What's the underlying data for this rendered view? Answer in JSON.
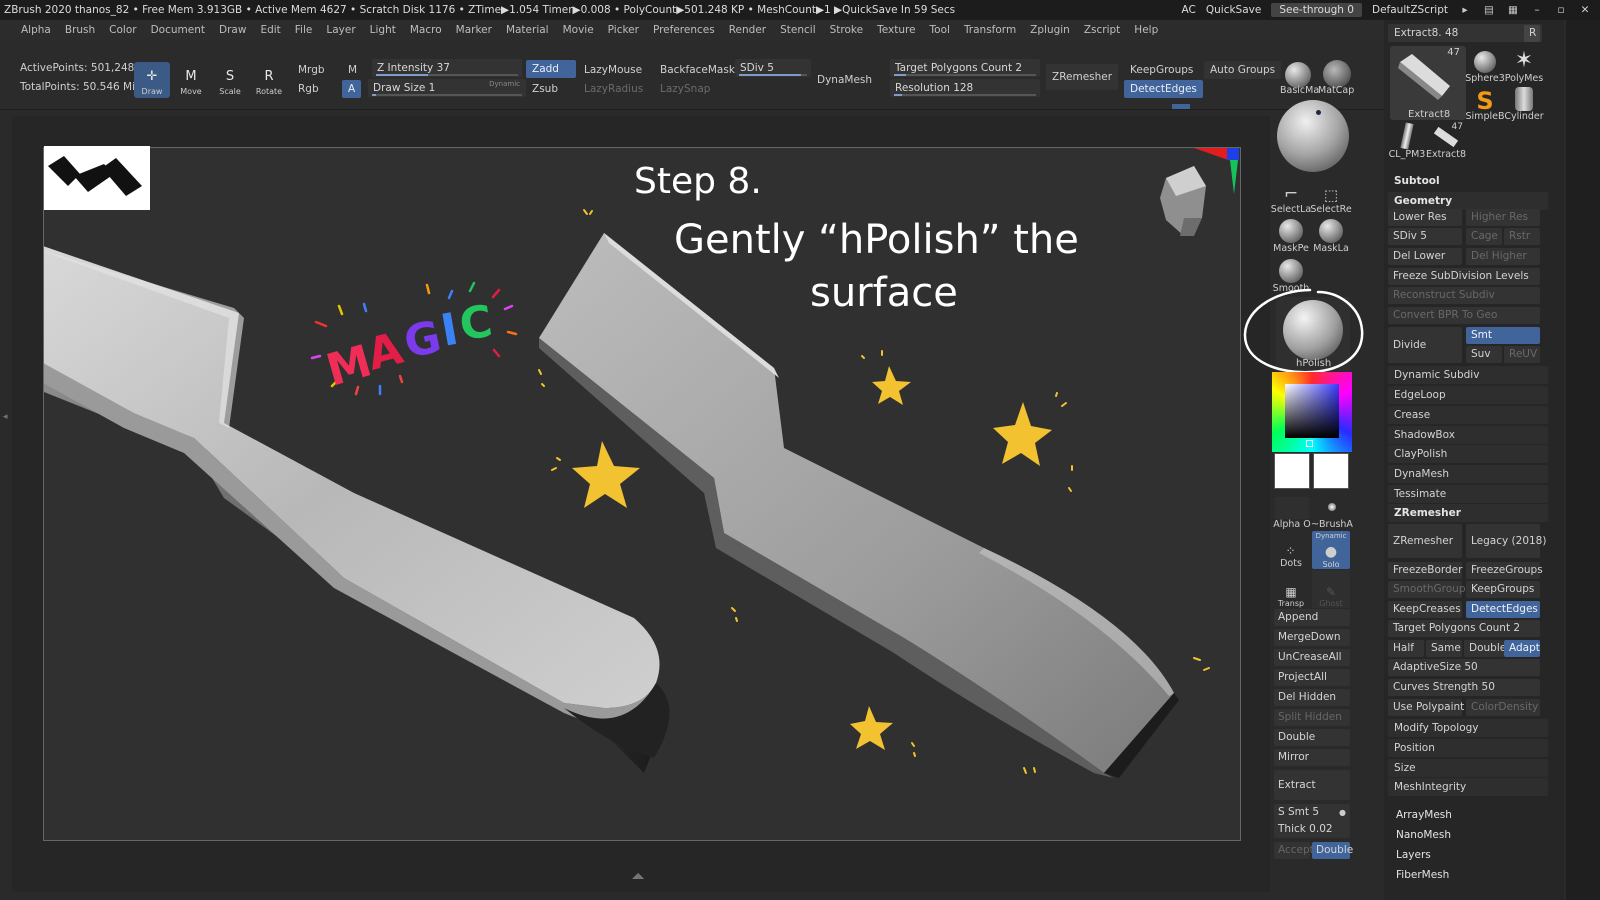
{
  "titlebar": {
    "text": "ZBrush 2020   thanos_82   • Free Mem 3.913GB • Active Mem 4627 • Scratch Disk 1176 • ZTime▶1.054 Timer▶0.008 • PolyCount▶501.248 KP  • MeshCount▶1  ▶QuickSave In 59 Secs",
    "ac": "AC",
    "quicksave": "QuickSave",
    "seethrough": "See-through  0",
    "script": "DefaultZScript"
  },
  "menus": [
    "Alpha",
    "Brush",
    "Color",
    "Document",
    "Draw",
    "Edit",
    "File",
    "Layer",
    "Light",
    "Macro",
    "Marker",
    "Material",
    "Movie",
    "Picker",
    "Preferences",
    "Render",
    "Stencil",
    "Stroke",
    "Texture",
    "Tool",
    "Transform",
    "Zplugin",
    "Zscript",
    "Help"
  ],
  "shelf": {
    "active_points": "ActivePoints: 501,248",
    "total_points": "TotalPoints: 50.546 Mil",
    "tools": [
      "Draw",
      "Move",
      "Scale",
      "Rotate"
    ],
    "mrgb": "Mrgb",
    "m": "M",
    "rgb": "Rgb",
    "a": "A",
    "z_intensity": "Z Intensity 37",
    "draw_size": "Draw Size 1",
    "dynamic": "Dynamic",
    "zadd": "Zadd",
    "zsub": "Zsub",
    "lazymouse": "LazyMouse",
    "lazyradius": "LazyRadius",
    "lazysnap": "LazySnap",
    "backfacemask": "BackfaceMask",
    "sdiv": "SDiv 5",
    "dynamesh": "DynaMesh",
    "target_polygons": "Target Polygons Count 2",
    "resolution": "Resolution 128",
    "zremesher": "ZRemesher",
    "keepgroups": "KeepGroups",
    "auto_groups": "Auto Groups",
    "detect_edges": "DetectEdges",
    "basic_material": "BasicMa",
    "matcap": "MatCap"
  },
  "canvas": {
    "step_title": "Step 8.",
    "caption_line1": "Gently “hPolish” the",
    "caption_line2": "surface",
    "magic": "MAGIC"
  },
  "midcol": {
    "select_lasso": "SelectLa",
    "select_rect": "SelectRe",
    "mask_pen": "MaskPe",
    "mask_lasso": "MaskLa",
    "smooth": "Smooth",
    "hpolish": "hPolish",
    "alpha_off": "Alpha O",
    "brush_alpha": "~BrushA",
    "dots": "Dots",
    "solo": "Solo",
    "dynamic": "Dynamic",
    "transp": "Transp",
    "ghost": "Ghost",
    "buttons": [
      "Append",
      "MergeDown",
      "UnCreaseAll",
      "ProjectAll",
      "Del Hidden",
      "Split Hidden",
      "Double",
      "Mirror"
    ],
    "extract": "Extract",
    "s_smt": "S Smt 5",
    "thick": "Thick 0.02",
    "accept": "Accept",
    "double": "Double"
  },
  "rpanel": {
    "tool_name": "Extract8. 48",
    "r_label": "R",
    "thumbs": [
      "Extract8",
      "Sphere3",
      "PolyMes",
      "SimpleB",
      "Cylinder",
      "CL_PM3",
      "Extract8"
    ],
    "thumb_count": "47",
    "subtool": "Subtool",
    "geometry": "Geometry",
    "lower_res": "Lower Res",
    "higher_res": "Higher Res",
    "sdiv": "SDiv 5",
    "cage": "Cage",
    "rstr": "Rstr",
    "del_lower": "Del Lower",
    "del_higher": "Del Higher",
    "freeze_subdiv": "Freeze SubDivision Levels",
    "reconstruct": "Reconstruct Subdiv",
    "convert_bpr": "Convert BPR To Geo",
    "divide": "Divide",
    "smt": "Smt",
    "suv": "Suv",
    "reuv": "ReUV",
    "dynamic_subdiv": "Dynamic Subdiv",
    "edgeloop": "EdgeLoop",
    "crease": "Crease",
    "shadowbox": "ShadowBox",
    "claypolish": "ClayPolish",
    "dynamesh": "DynaMesh",
    "tessimate": "Tessimate",
    "zremesher_sec": "ZRemesher",
    "zremesher_btn": "ZRemesher",
    "legacy": "Legacy (2018)",
    "freezeborder": "FreezeBorder",
    "freezegroups": "FreezeGroups",
    "smoothgroups": "SmoothGroups",
    "keepgroups": "KeepGroups",
    "keepcreases": "KeepCreases",
    "detectedges": "DetectEdges",
    "target_polygons": "Target Polygons Count 2",
    "half": "Half",
    "same": "Same",
    "double": "Double",
    "adapt": "Adapt",
    "adaptive_size": "AdaptiveSize 50",
    "curves_strength": "Curves Strength 50",
    "use_polypaint": "Use Polypaint",
    "color_density": "ColorDensity",
    "modify_topology": "Modify Topology",
    "position": "Position",
    "size": "Size",
    "meshintegrity": "MeshIntegrity",
    "arraymesh": "ArrayMesh",
    "nanomesh": "NanoMesh",
    "layers": "Layers",
    "fibermesh": "FiberMesh"
  },
  "colors": {
    "accent_blue": "#41659a",
    "star_yellow": "#f2c230"
  }
}
